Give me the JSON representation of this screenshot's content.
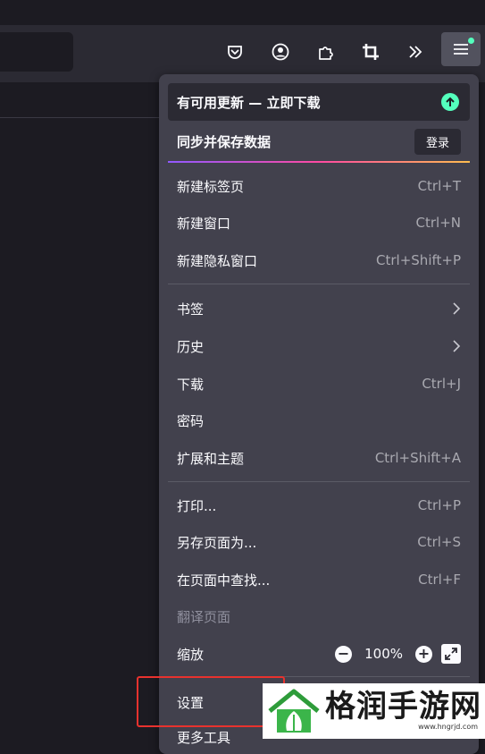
{
  "toolbar": {
    "icons": [
      "pocket-icon",
      "account-icon",
      "extensions-icon",
      "screenshot-icon",
      "overflow-icon",
      "app-menu-icon"
    ],
    "accent": "#54ffbd"
  },
  "menu": {
    "update_label": "有可用更新 — 立即下载",
    "sync_label": "同步并保存数据",
    "login_label": "登录",
    "items": [
      {
        "label": "新建标签页",
        "shortcut": "Ctrl+T"
      },
      {
        "label": "新建窗口",
        "shortcut": "Ctrl+N"
      },
      {
        "label": "新建隐私窗口",
        "shortcut": "Ctrl+Shift+P"
      },
      {
        "label": "书签",
        "shortcut": ""
      },
      {
        "label": "历史",
        "shortcut": ""
      },
      {
        "label": "下载",
        "shortcut": "Ctrl+J"
      },
      {
        "label": "密码",
        "shortcut": ""
      },
      {
        "label": "扩展和主题",
        "shortcut": "Ctrl+Shift+A"
      },
      {
        "label": "打印...",
        "shortcut": "Ctrl+P"
      },
      {
        "label": "另存页面为...",
        "shortcut": "Ctrl+S"
      },
      {
        "label": "在页面中查找...",
        "shortcut": "Ctrl+F"
      },
      {
        "label": "翻译页面",
        "shortcut": ""
      },
      {
        "label": "缩放",
        "shortcut": ""
      },
      {
        "label": "设置",
        "shortcut": ""
      },
      {
        "label": "更多工具",
        "shortcut": ""
      }
    ],
    "zoom": {
      "minus": "−",
      "value": "100%",
      "plus": "+"
    }
  },
  "watermark": {
    "title": "格润手游网",
    "url": "www.hngrjd.com"
  }
}
